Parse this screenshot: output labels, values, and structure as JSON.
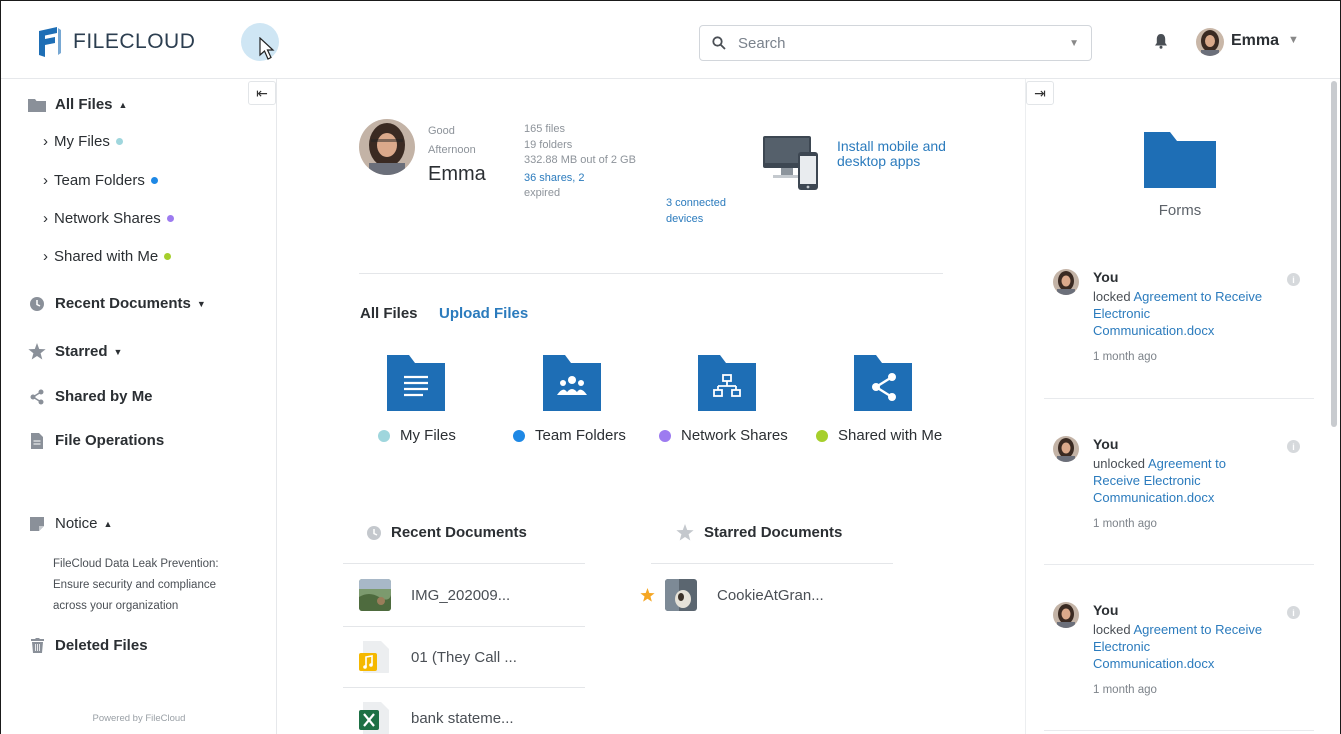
{
  "header": {
    "logo_text": "FILECLOUD",
    "search_placeholder": "Search",
    "user_name": "Emma"
  },
  "sidebar": {
    "all_files": "All Files",
    "sub_items": [
      {
        "label": "My Files",
        "color": "#9fd6dd"
      },
      {
        "label": "Team Folders",
        "color": "#1e88e5"
      },
      {
        "label": "Network Shares",
        "color": "#9d7bf0"
      },
      {
        "label": "Shared with Me",
        "color": "#a6cf2c"
      }
    ],
    "recent_documents": "Recent Documents",
    "starred": "Starred",
    "shared_by_me": "Shared by Me",
    "file_operations": "File Operations",
    "notice": "Notice",
    "notice_text": "FileCloud Data Leak Prevention: Ensure security and compliance across your organization",
    "deleted_files": "Deleted Files",
    "powered_by": "Powered by FileCloud"
  },
  "profile": {
    "greeting": "Good Afternoon",
    "name": "Emma",
    "files": "165 files",
    "folders": "19 folders",
    "storage": "332.88 MB out of 2 GB",
    "shares": "36 shares, 2",
    "expired": "expired",
    "devices": "3 connected devices",
    "install": "Install mobile and desktop apps"
  },
  "tabs": {
    "all_files": "All Files",
    "upload_files": "Upload Files"
  },
  "folders": [
    {
      "label": "My Files",
      "color": "#9fd6dd",
      "icon": "document-lines-icon"
    },
    {
      "label": "Team Folders",
      "color": "#1e88e5",
      "icon": "team-icon"
    },
    {
      "label": "Network Shares",
      "color": "#9d7bf0",
      "icon": "network-icon"
    },
    {
      "label": "Shared with Me",
      "color": "#a6cf2c",
      "icon": "share-icon"
    }
  ],
  "recent": {
    "title": "Recent Documents",
    "items": [
      {
        "name": "IMG_202009...",
        "icon": "image-thumb-icon"
      },
      {
        "name": "01 (They Call ...",
        "icon": "music-file-icon"
      },
      {
        "name": "bank stateme...",
        "icon": "excel-file-icon"
      }
    ]
  },
  "starred": {
    "title": "Starred Documents",
    "items": [
      {
        "name": "CookieAtGran...",
        "icon": "image-thumb-icon"
      }
    ]
  },
  "right_panel": {
    "forms_label": "Forms",
    "activities": [
      {
        "who": "You",
        "verb": "locked",
        "target": "Agreement to Receive Electronic Communication.docx",
        "time": "1 month ago"
      },
      {
        "who": "You",
        "verb": "unlocked",
        "target": "Agreement to Receive Electronic Communication.docx",
        "time": "1 month ago"
      },
      {
        "who": "You",
        "verb": "locked",
        "target": "Agreement to Receive Electronic Communication.docx",
        "time": "1 month ago"
      }
    ]
  },
  "colors": {
    "brand_blue": "#1e6eb5",
    "link_blue": "#2b7bbd"
  }
}
